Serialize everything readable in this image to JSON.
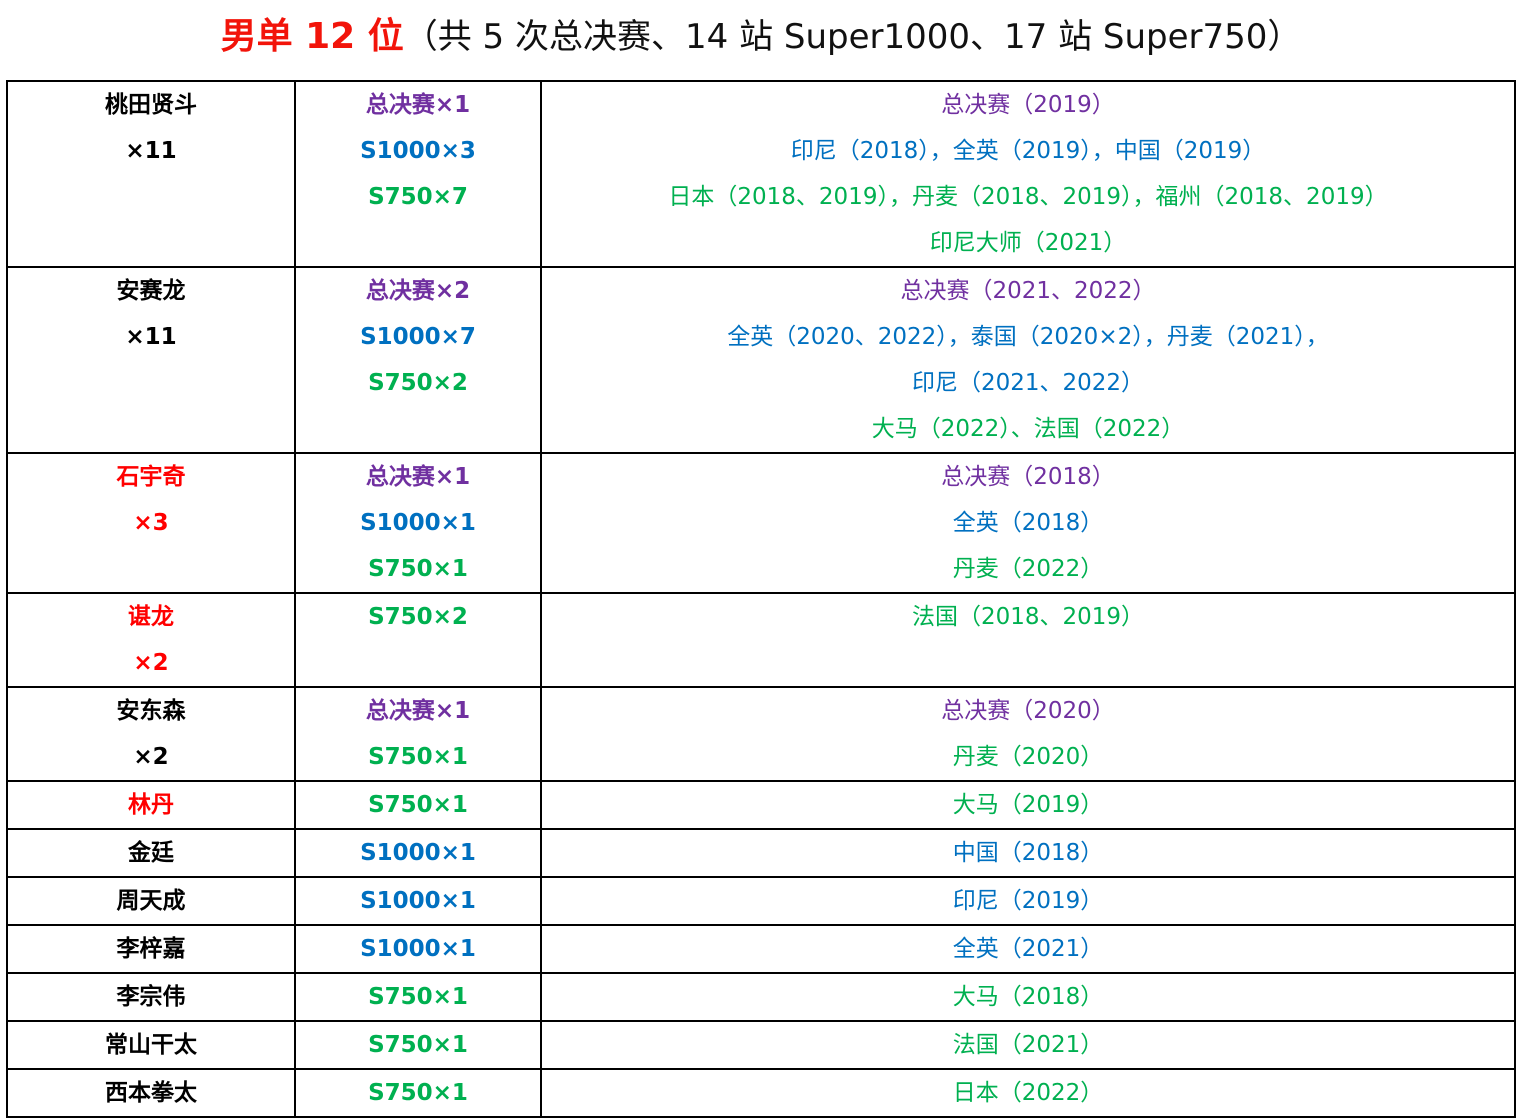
{
  "title": {
    "main": "男单 12 位",
    "sub": "（共 5 次总决赛、14 站 Super1000、17 站 Super750）"
  },
  "colors": {
    "final": "#7030a0",
    "s1000": "#0070c0",
    "s750": "#00b050",
    "highlight": "#ff0000",
    "normal": "#000000"
  },
  "rows": [
    {
      "name": "桃田贤斗",
      "count": "×11",
      "red": false,
      "summary": [
        {
          "text": "总决赛×1",
          "cat": "final"
        },
        {
          "text": "S1000×3",
          "cat": "s1000"
        },
        {
          "text": "S750×7",
          "cat": "s750"
        }
      ],
      "details": [
        {
          "text": "总决赛（2019）",
          "cat": "final"
        },
        {
          "text": "印尼（2018），全英（2019），中国（2019）",
          "cat": "s1000"
        },
        {
          "text": "日本（2018、2019），丹麦（2018、2019），福州（2018、2019）",
          "cat": "s750"
        },
        {
          "text": "印尼大师（2021）",
          "cat": "s750"
        }
      ]
    },
    {
      "name": "安赛龙",
      "count": "×11",
      "red": false,
      "summary": [
        {
          "text": "总决赛×2",
          "cat": "final"
        },
        {
          "text": "S1000×7",
          "cat": "s1000"
        },
        {
          "text": "S750×2",
          "cat": "s750"
        }
      ],
      "details": [
        {
          "text": "总决赛（2021、2022）",
          "cat": "final"
        },
        {
          "text": "全英（2020、2022），泰国（2020×2），丹麦（2021），",
          "cat": "s1000"
        },
        {
          "text": "印尼（2021、2022）",
          "cat": "s1000"
        },
        {
          "text": "大马（2022）、法国（2022）",
          "cat": "s750"
        }
      ]
    },
    {
      "name": "石宇奇",
      "count": "×3",
      "red": true,
      "summary": [
        {
          "text": "总决赛×1",
          "cat": "final"
        },
        {
          "text": "S1000×1",
          "cat": "s1000"
        },
        {
          "text": "S750×1",
          "cat": "s750"
        }
      ],
      "details": [
        {
          "text": "总决赛（2018）",
          "cat": "final"
        },
        {
          "text": "全英（2018）",
          "cat": "s1000"
        },
        {
          "text": "丹麦（2022）",
          "cat": "s750"
        }
      ]
    },
    {
      "name": "谌龙",
      "count": "×2",
      "red": true,
      "summary": [
        {
          "text": "S750×2",
          "cat": "s750"
        }
      ],
      "details": [
        {
          "text": "法国（2018、2019）",
          "cat": "s750"
        }
      ]
    },
    {
      "name": "安东森",
      "count": "×2",
      "red": false,
      "summary": [
        {
          "text": "总决赛×1",
          "cat": "final"
        },
        {
          "text": "S750×1",
          "cat": "s750"
        }
      ],
      "details": [
        {
          "text": "总决赛（2020）",
          "cat": "final"
        },
        {
          "text": "丹麦（2020）",
          "cat": "s750"
        }
      ]
    },
    {
      "name": "林丹",
      "count": "",
      "red": true,
      "summary": [
        {
          "text": "S750×1",
          "cat": "s750"
        }
      ],
      "details": [
        {
          "text": "大马（2019）",
          "cat": "s750"
        }
      ]
    },
    {
      "name": "金廷",
      "count": "",
      "red": false,
      "summary": [
        {
          "text": "S1000×1",
          "cat": "s1000"
        }
      ],
      "details": [
        {
          "text": "中国（2018）",
          "cat": "s1000"
        }
      ]
    },
    {
      "name": "周天成",
      "count": "",
      "red": false,
      "summary": [
        {
          "text": "S1000×1",
          "cat": "s1000"
        }
      ],
      "details": [
        {
          "text": "印尼（2019）",
          "cat": "s1000"
        }
      ]
    },
    {
      "name": "李梓嘉",
      "count": "",
      "red": false,
      "summary": [
        {
          "text": "S1000×1",
          "cat": "s1000"
        }
      ],
      "details": [
        {
          "text": "全英（2021）",
          "cat": "s1000"
        }
      ]
    },
    {
      "name": "李宗伟",
      "count": "",
      "red": false,
      "summary": [
        {
          "text": "S750×1",
          "cat": "s750"
        }
      ],
      "details": [
        {
          "text": "大马（2018）",
          "cat": "s750"
        }
      ]
    },
    {
      "name": "常山干太",
      "count": "",
      "red": false,
      "summary": [
        {
          "text": "S750×1",
          "cat": "s750"
        }
      ],
      "details": [
        {
          "text": "法国（2021）",
          "cat": "s750"
        }
      ]
    },
    {
      "name": "西本拳太",
      "count": "",
      "red": false,
      "summary": [
        {
          "text": "S750×1",
          "cat": "s750"
        }
      ],
      "details": [
        {
          "text": "日本（2022）",
          "cat": "s750"
        }
      ]
    }
  ]
}
